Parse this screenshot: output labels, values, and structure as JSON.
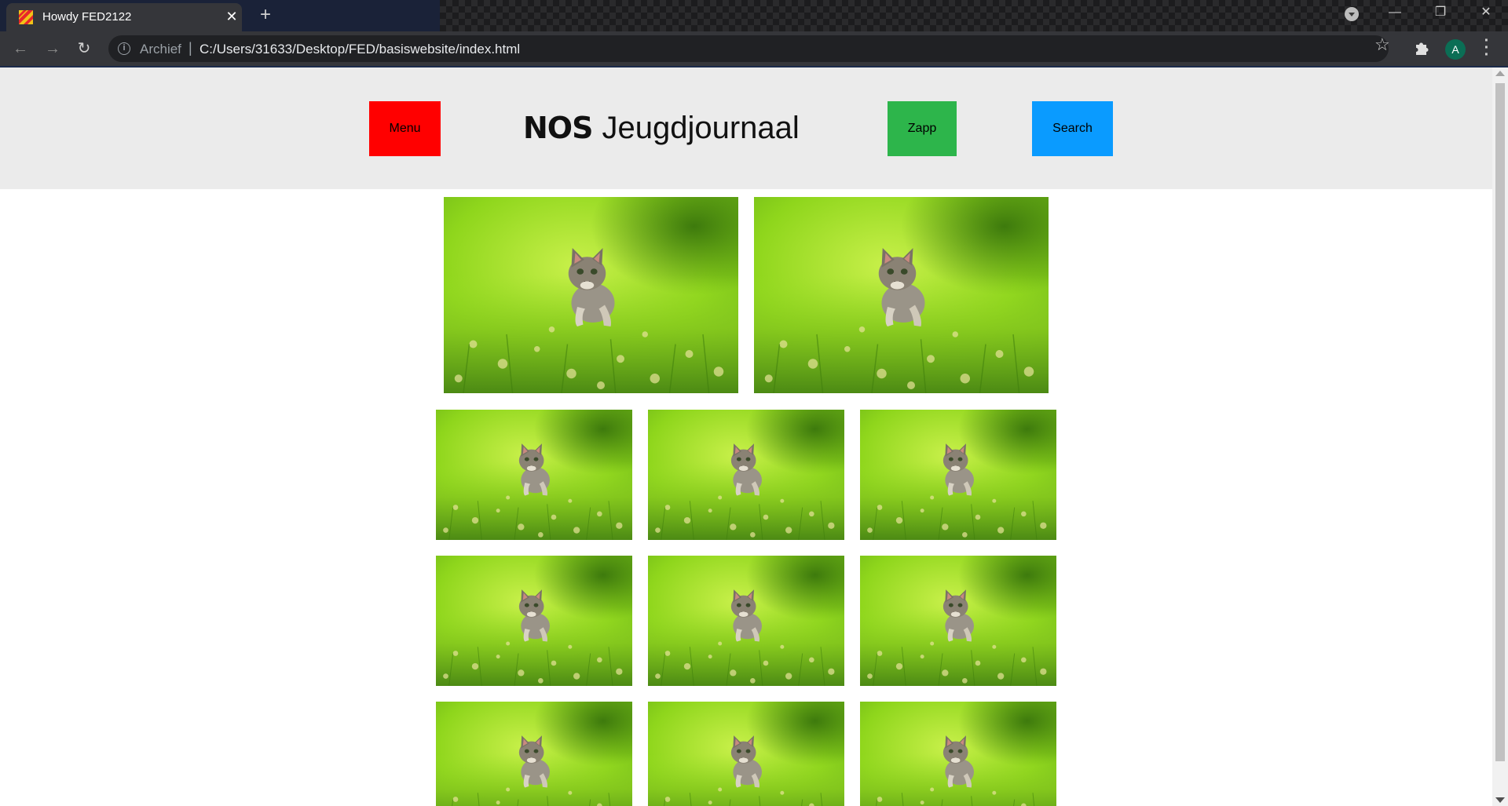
{
  "browser": {
    "tab_title": "Howdy FED2122",
    "tab_close": "✕",
    "new_tab": "+",
    "address_prefix": "Archief",
    "address_separator": "|",
    "url": "C:/Users/31633/Desktop/FED/basiswebsite/index.html",
    "profile_initial": "A",
    "profile_color": "#0b6e55",
    "window_controls": {
      "minimize": "—",
      "restore": "❐",
      "close": "✕"
    },
    "nav": {
      "back": "←",
      "forward": "→",
      "reload": "↻"
    }
  },
  "site": {
    "header_bg": "#ebebeb",
    "menu_button": {
      "label": "Menu",
      "color": "#ff0000"
    },
    "logo": {
      "brand": "NOS",
      "name": "Jeugdjournaal"
    },
    "zapp_button": {
      "label": "Zapp",
      "color": "#2db54b"
    },
    "search_button": {
      "label": "Search",
      "color": "#0a9bff"
    },
    "gallery": {
      "image_subject": "kitten-running-in-grass",
      "large_images": 2,
      "small_rows": 3,
      "small_per_row": 3
    }
  }
}
